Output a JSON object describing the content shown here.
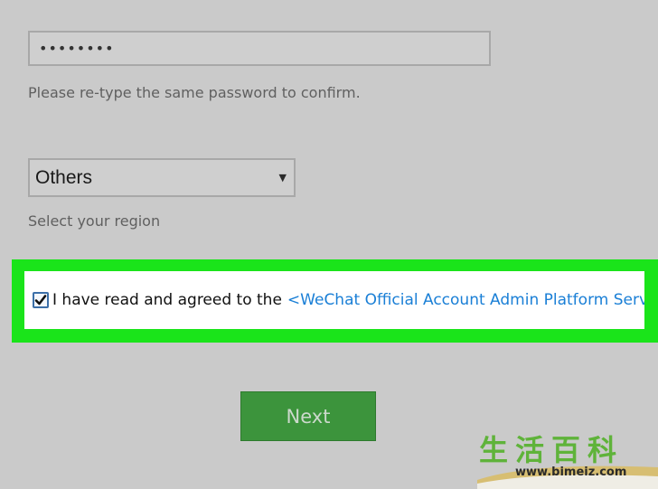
{
  "password_confirm": {
    "masked_value": "••••••••",
    "hint": "Please re-type the same password to confirm."
  },
  "region": {
    "selected": "Others",
    "hint": "Select your region"
  },
  "agreement": {
    "checked": true,
    "text": "I have read and agreed to the",
    "link": "<WeChat Official Account Admin Platform Servic"
  },
  "next_label": "Next",
  "watermark": {
    "chars": "生活百科",
    "url": "www.bimeiz.com"
  },
  "colors": {
    "highlight": "#1ae41a",
    "button": "#3c943c",
    "link": "#1a7fd6"
  }
}
